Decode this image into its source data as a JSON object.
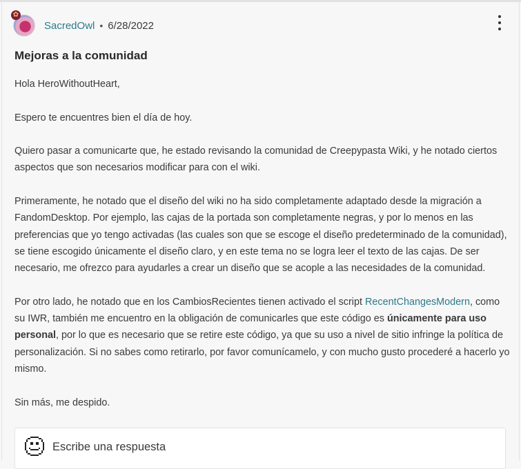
{
  "post": {
    "badge_icon": "flower-badge-icon",
    "author": "SacredOwl",
    "separator": "•",
    "date": "6/28/2022",
    "title": "Mejoras a la comunidad",
    "greeting": "Hola HeroWithoutHeart,",
    "p1": "Espero te encuentres bien el día de hoy.",
    "p2": "Quiero pasar a comunicarte que, he estado revisando la comunidad de Creepypasta Wiki, y he notado ciertos aspectos que son necesarios modificar para con el wiki.",
    "p3": "Primeramente, he notado que el diseño del wiki no ha sido completamente adaptado desde la migración a FandomDesktop. Por ejemplo, las cajas de la portada son completamente negras, y por lo menos en las preferencias que yo tengo activadas (las cuales son que se escoge el diseño predeterminado de la comunidad), se tiene escogido únicamente el diseño claro, y en este tema no se logra leer el texto de las cajas. De ser necesario, me ofrezco para ayudarles a crear un diseño que se acople a las necesidades de la comunidad.",
    "p4": {
      "before_link": "Por otro lado, he notado que en los CambiosRecientes tienen activado el script ",
      "link": "RecentChangesModern",
      "after_link": ", como su IWR, también me encuentro en la obligación de comunicarles que este código es ",
      "bold": "únicamente para uso personal",
      "after_bold": ", por lo que es necesario que se retire este código, ya que su uso a nivel de sitio infringe la política de personalización. Si no sabes como retirarlo, por favor comunícamelo, y con mucho gusto procederé a hacerlo yo mismo."
    },
    "closing": "Sin más, me despido."
  },
  "reply": {
    "placeholder": "Escribe una respuesta",
    "icon": "pixel-smiley-icon"
  },
  "colors": {
    "link": "#2b7a8b",
    "background": "#f7f7f7",
    "text": "#3a3a3a"
  }
}
